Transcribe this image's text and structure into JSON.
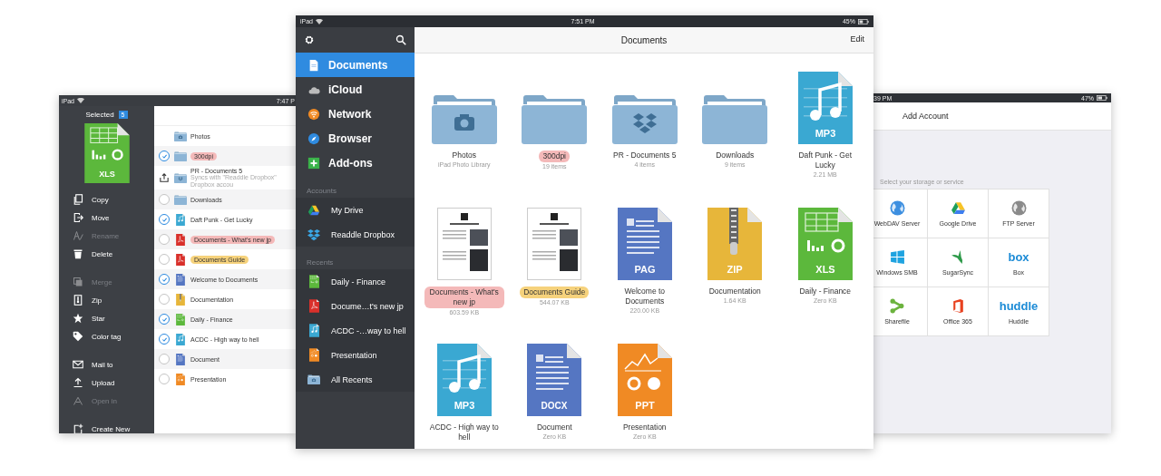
{
  "left_screen": {
    "status": {
      "carrier": "iPad",
      "time": "7:47 P"
    },
    "selected_label": "Selected",
    "selected_count": "5",
    "preview": {
      "kind": "xls",
      "badge": "XLS"
    },
    "action_groups": [
      [
        {
          "label": "Copy",
          "kind": "copy",
          "disabled": false
        },
        {
          "label": "Move",
          "kind": "move",
          "disabled": false
        },
        {
          "label": "Rename",
          "kind": "rename",
          "disabled": true
        },
        {
          "label": "Delete",
          "kind": "delete",
          "disabled": false
        }
      ],
      [
        {
          "label": "Merge",
          "kind": "merge",
          "disabled": true
        },
        {
          "label": "Zip",
          "kind": "zip",
          "disabled": false
        },
        {
          "label": "Star",
          "kind": "star",
          "disabled": false
        },
        {
          "label": "Color tag",
          "kind": "tag",
          "disabled": false
        }
      ],
      [
        {
          "label": "Mail to",
          "kind": "mail",
          "disabled": false
        },
        {
          "label": "Upload",
          "kind": "upload",
          "disabled": false
        },
        {
          "label": "Open in",
          "kind": "open",
          "disabled": true
        }
      ],
      [
        {
          "label": "Create New",
          "kind": "create",
          "disabled": false
        }
      ]
    ],
    "files": [
      {
        "name": "Photos",
        "kind": "folder-photos"
      },
      {
        "name": "300dpi",
        "kind": "folder",
        "control": {
          "kind": "checkbox",
          "checked": true
        },
        "color": "#f4b9b9"
      },
      {
        "name": "PR - Documents 5",
        "subtitle": "Syncs with \"Readdle Dropbox\" Dropbox accou",
        "kind": "folder-dropbox",
        "control": {
          "kind": "sync"
        }
      },
      {
        "name": "Downloads",
        "kind": "folder",
        "control": {
          "kind": "checkbox",
          "checked": false
        }
      },
      {
        "name": "Daft Punk - Get Lucky",
        "kind": "mp3",
        "control": {
          "kind": "checkbox",
          "checked": true
        }
      },
      {
        "name": "Documents - What's new jp",
        "kind": "pdf",
        "control": {
          "kind": "checkbox",
          "checked": false
        },
        "color": "#f4b9b9"
      },
      {
        "name": "Documents Guide",
        "kind": "pdf",
        "control": {
          "kind": "checkbox",
          "checked": false
        },
        "color": "#f6d27c"
      },
      {
        "name": "Welcome to Documents",
        "kind": "pag",
        "control": {
          "kind": "checkbox",
          "checked": true
        }
      },
      {
        "name": "Documentation",
        "kind": "zip",
        "control": {
          "kind": "checkbox",
          "checked": false
        }
      },
      {
        "name": "Daily - Finance",
        "kind": "xls",
        "control": {
          "kind": "checkbox",
          "checked": true
        }
      },
      {
        "name": "ACDC - High way to hell",
        "kind": "mp3",
        "control": {
          "kind": "checkbox",
          "checked": true
        }
      },
      {
        "name": "Document",
        "kind": "docx",
        "control": {
          "kind": "checkbox",
          "checked": false
        }
      },
      {
        "name": "Presentation",
        "kind": "ppt",
        "control": {
          "kind": "checkbox",
          "checked": false
        }
      }
    ]
  },
  "main_screen": {
    "status": {
      "carrier": "iPad",
      "time": "7:51 PM",
      "battery": "45%"
    },
    "title": "Documents",
    "edit": "Edit",
    "nav": [
      {
        "label": "Documents",
        "kind": "document",
        "selected": true
      },
      {
        "label": "iCloud",
        "kind": "cloud",
        "selected": false
      },
      {
        "label": "Network",
        "kind": "network",
        "selected": false
      },
      {
        "label": "Browser",
        "kind": "browser",
        "selected": false
      },
      {
        "label": "Add-ons",
        "kind": "addons",
        "selected": false
      }
    ],
    "accounts_heading": "Accounts",
    "accounts": [
      {
        "label": "My Drive",
        "kind": "drive"
      },
      {
        "label": "Readdle Dropbox",
        "kind": "dropbox"
      }
    ],
    "recents_heading": "Recents",
    "recents": [
      {
        "label": "Daily - Finance",
        "kind": "xls"
      },
      {
        "label": "Docume…t's new jp",
        "kind": "pdf"
      },
      {
        "label": "ACDC -…way to hell",
        "kind": "mp3"
      },
      {
        "label": "Presentation",
        "kind": "ppt"
      },
      {
        "label": "All Recents",
        "kind": "folder-photos"
      }
    ],
    "items": [
      {
        "name": "Photos",
        "detail": "iPad Photo Library",
        "kind": "folder-photos"
      },
      {
        "name": "300dpi",
        "detail": "19 items",
        "kind": "folder",
        "color": "#f4b9b9"
      },
      {
        "name": "PR - Documents 5",
        "detail": "4 items",
        "kind": "folder-dropbox"
      },
      {
        "name": "Downloads",
        "detail": "9 items",
        "kind": "folder"
      },
      {
        "name": "Daft Punk - Get Lucky",
        "detail": "2.21 MB",
        "kind": "mp3",
        "badge": "MP3"
      },
      {
        "name": "Documents - What's new jp",
        "detail": "603.59 KB",
        "kind": "doc-preview",
        "color": "#f4b9b9"
      },
      {
        "name": "Documents Guide",
        "detail": "544.07 KB",
        "kind": "doc-preview",
        "color": "#f6d27c"
      },
      {
        "name": "Welcome to Documents",
        "detail": "220.00 KB",
        "kind": "pag",
        "badge": "PAG"
      },
      {
        "name": "Documentation",
        "detail": "1.64 KB",
        "kind": "zip",
        "badge": "ZIP"
      },
      {
        "name": "Daily - Finance",
        "detail": "Zero KB",
        "kind": "xls",
        "badge": "XLS"
      },
      {
        "name": "ACDC - High way to hell",
        "kind": "mp3",
        "badge": "MP3"
      },
      {
        "name": "Document",
        "detail": "Zero KB",
        "kind": "docx",
        "badge": "DOCX"
      },
      {
        "name": "Presentation",
        "detail": "Zero KB",
        "kind": "ppt",
        "badge": "PPT"
      }
    ]
  },
  "right_screen": {
    "status": {
      "time": "39 PM",
      "battery": "47%"
    },
    "title": "Add Account",
    "prompt": "Select your storage or service",
    "services": [
      {
        "label": "WebDAV Server",
        "kind": "globe"
      },
      {
        "label": "Google Drive",
        "kind": "drive"
      },
      {
        "label": "FTP Server",
        "kind": "globe-grey"
      },
      {
        "label": "Windows SMB",
        "kind": "tiles"
      },
      {
        "label": "SugarSync",
        "kind": "bird"
      },
      {
        "label": "Box",
        "kind": "logo-text",
        "logo": "box"
      },
      {
        "label": "Sharefile",
        "kind": "nodes"
      },
      {
        "label": "Office 365",
        "kind": "office"
      },
      {
        "label": "Huddle",
        "kind": "logo-text",
        "logo": "huddle"
      }
    ]
  }
}
